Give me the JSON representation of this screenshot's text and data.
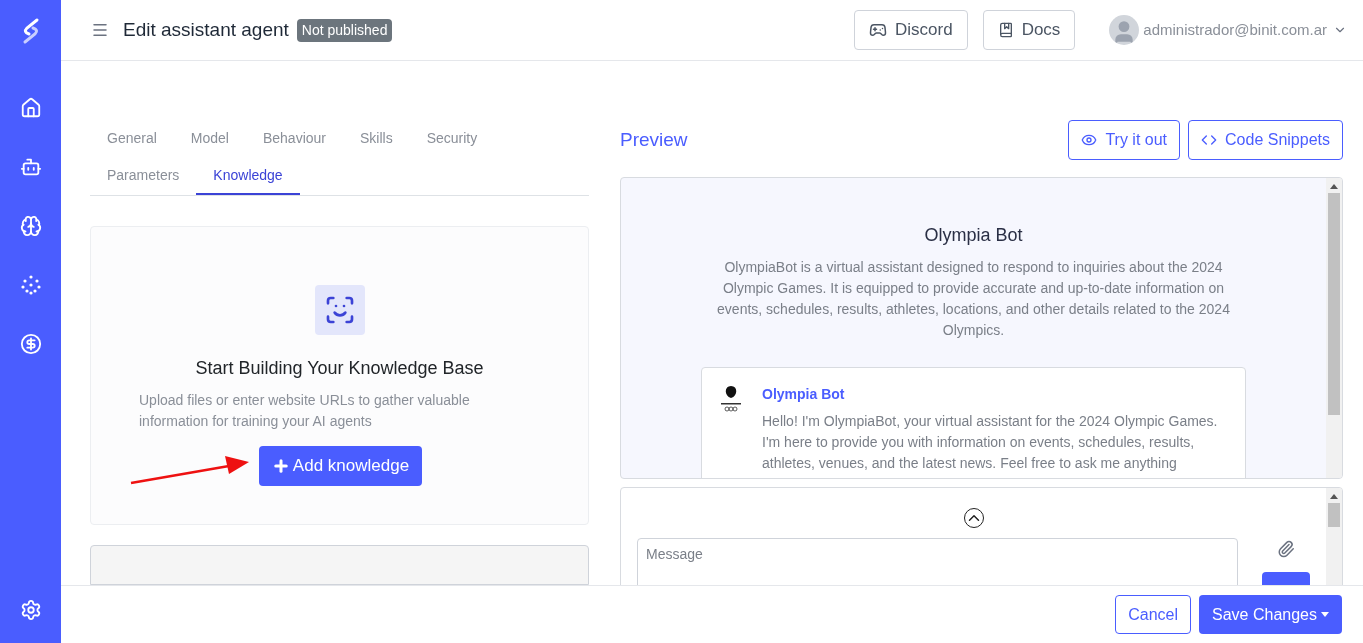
{
  "header": {
    "title": "Edit assistant agent",
    "badge": "Not published",
    "buttons": [
      {
        "kind": "discord",
        "label": "Discord"
      },
      {
        "kind": "docs",
        "label": "Docs"
      }
    ],
    "user": "administrador@binit.com.ar"
  },
  "sidebar": {
    "items": [
      {
        "kind": "home",
        "selected": false
      },
      {
        "kind": "bot",
        "selected": false
      },
      {
        "kind": "brain",
        "selected": false
      },
      {
        "kind": "dots",
        "selected": false
      },
      {
        "kind": "dollar",
        "selected": false
      }
    ]
  },
  "tabs": [
    [
      {
        "label": "General",
        "selected": false
      },
      {
        "label": "Model",
        "selected": false
      },
      {
        "label": "Behaviour",
        "selected": false
      },
      {
        "label": "Skills",
        "selected": false
      },
      {
        "label": "Security",
        "selected": false
      }
    ],
    [
      {
        "label": "Parameters",
        "selected": false
      },
      {
        "label": "Knowledge",
        "selected": true
      }
    ]
  ],
  "empty_state": {
    "title": "Start Building Your Knowledge Base",
    "text": "Upload files or enter website URLs to gather valuable information for training your AI agents",
    "button": "Add knowledge"
  },
  "preview": {
    "title": "Preview",
    "buttons": [
      {
        "kind": "eye",
        "label": "Try it out"
      },
      {
        "kind": "code",
        "label": "Code Snippets"
      }
    ],
    "bot_name": "Olympia Bot",
    "bot_description": "OlympiaBot is a virtual assistant designed to respond to inquiries about the 2024 Olympic Games. It is equipped to provide accurate and up-to-date information on events, schedules, results, athletes, locations, and other details related to the 2024 Olympics.",
    "message": {
      "sender": "Olympia Bot",
      "text": "Hello! I'm OlympiaBot, your virtual assistant for the 2024 Olympic Games. I'm here to provide you with information on events, schedules, results, athletes, venues, and the latest news. Feel free to ask me anything"
    },
    "input": {
      "placeholder": "Message"
    }
  },
  "footer": {
    "cancel": "Cancel",
    "save": "Save Changes"
  }
}
